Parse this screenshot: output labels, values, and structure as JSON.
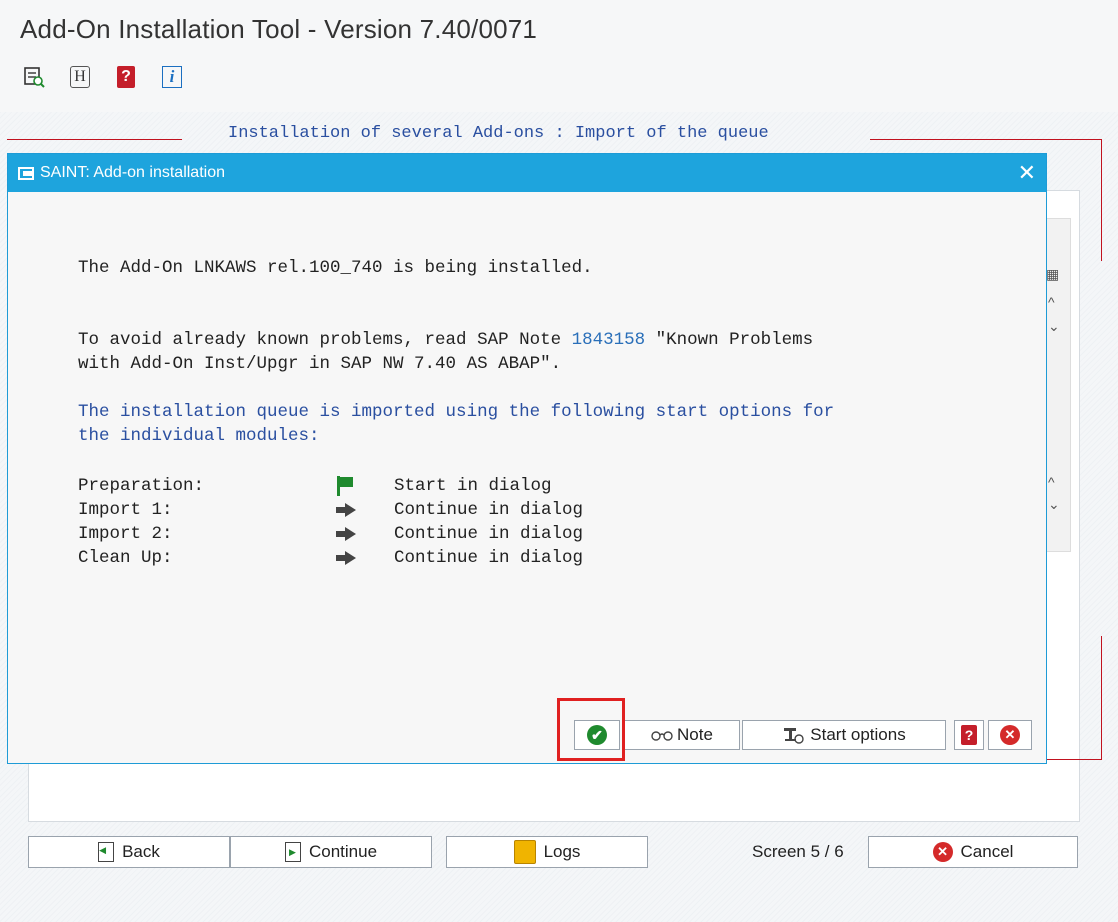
{
  "app": {
    "title": "Add-On Installation Tool - Version 7.40/0071",
    "toolbar": [
      "tree-icon",
      "h-icon",
      "help-icon",
      "info-icon"
    ],
    "toolbar_h_glyph": "H",
    "toolbar_info_glyph": "i",
    "section_heading": "Installation of several Add-ons : Import of the queue"
  },
  "dialog": {
    "title": "SAINT: Add-on installation",
    "close_glyph": "✕",
    "line1": "The Add-On LNKAWS rel.100_740 is being installed.",
    "note_prefix": "To avoid already known problems, read SAP Note ",
    "note_number": "1843158",
    "note_suffix": " \"Known Problems",
    "note_line2": "with Add-On Inst/Upgr in SAP NW 7.40 AS ABAP\".",
    "queue_line1": "The installation queue is imported using the following start options for",
    "queue_line2": "the individual modules:",
    "options": [
      {
        "label": "Preparation:",
        "icon": "flag-icon",
        "value": "Start in dialog"
      },
      {
        "label": "Import 1:",
        "icon": "arrow-icon",
        "value": "Continue in dialog"
      },
      {
        "label": "Import 2:",
        "icon": "arrow-icon",
        "value": "Continue in dialog"
      },
      {
        "label": "Clean Up:",
        "icon": "arrow-icon",
        "value": "Continue in dialog"
      }
    ],
    "buttons": {
      "ok_glyph": "✔",
      "note_label": "Note",
      "start_options_label": "Start options",
      "help_glyph": "?",
      "cancel_glyph": "✕"
    }
  },
  "footer": {
    "back_label": "Back",
    "continue_label": "Continue",
    "logs_label": "Logs",
    "screen_count": "Screen 5 / 6",
    "cancel_label": "Cancel",
    "cancel_glyph": "✕"
  },
  "colors": {
    "dialog_header": "#1ea4dd",
    "annotation_red": "#e02020",
    "ok_green": "#1f8a2e",
    "cancel_red": "#d42a2a"
  }
}
